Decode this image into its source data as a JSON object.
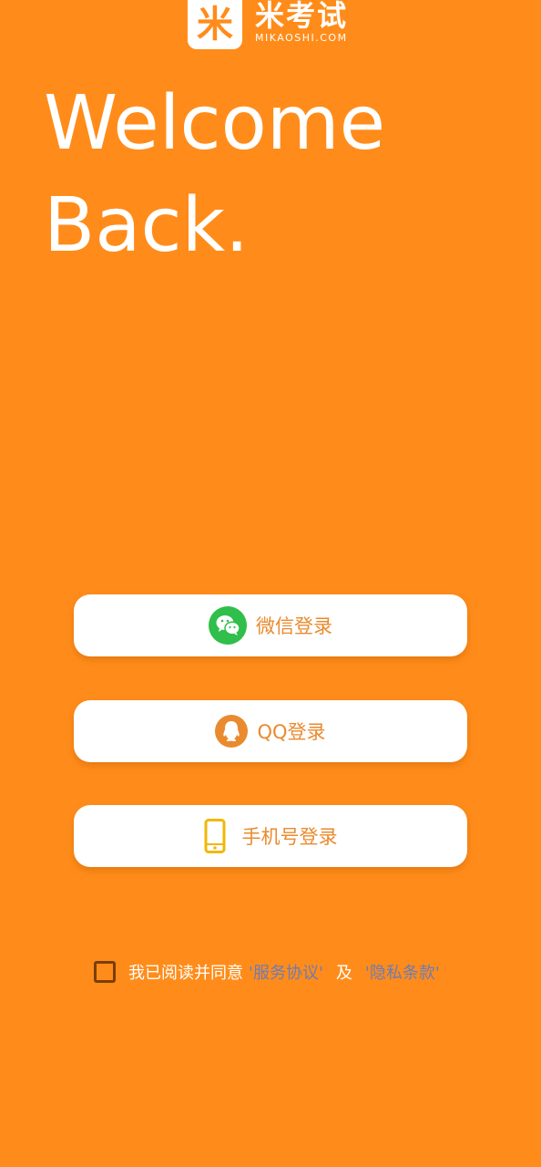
{
  "colors": {
    "background": "#FF8C1A",
    "button_bg": "#ffffff",
    "button_text": "#EA8A2E",
    "wechat_green": "#2FBF4A",
    "qq_orange": "#EA8A2E",
    "phone_yellow": "#F2B705",
    "link": "#6E7BB5",
    "checkbox_border": "#7A3E08"
  },
  "logo": {
    "mark": "米",
    "name": "米考试",
    "domain": "MIKAOSHI.COM"
  },
  "headline": {
    "line1": "Welcome",
    "line2": "Back."
  },
  "login_buttons": {
    "wechat": {
      "label": "微信登录",
      "icon": "wechat-icon"
    },
    "qq": {
      "label": "QQ登录",
      "icon": "qq-icon"
    },
    "phone": {
      "label": "手机号登录",
      "icon": "phone-icon"
    }
  },
  "agreement": {
    "prefix": "我已阅读并同意",
    "service_link": "'服务协议'",
    "conjunction": "及",
    "privacy_link": "'隐私条款'",
    "checked": false
  }
}
